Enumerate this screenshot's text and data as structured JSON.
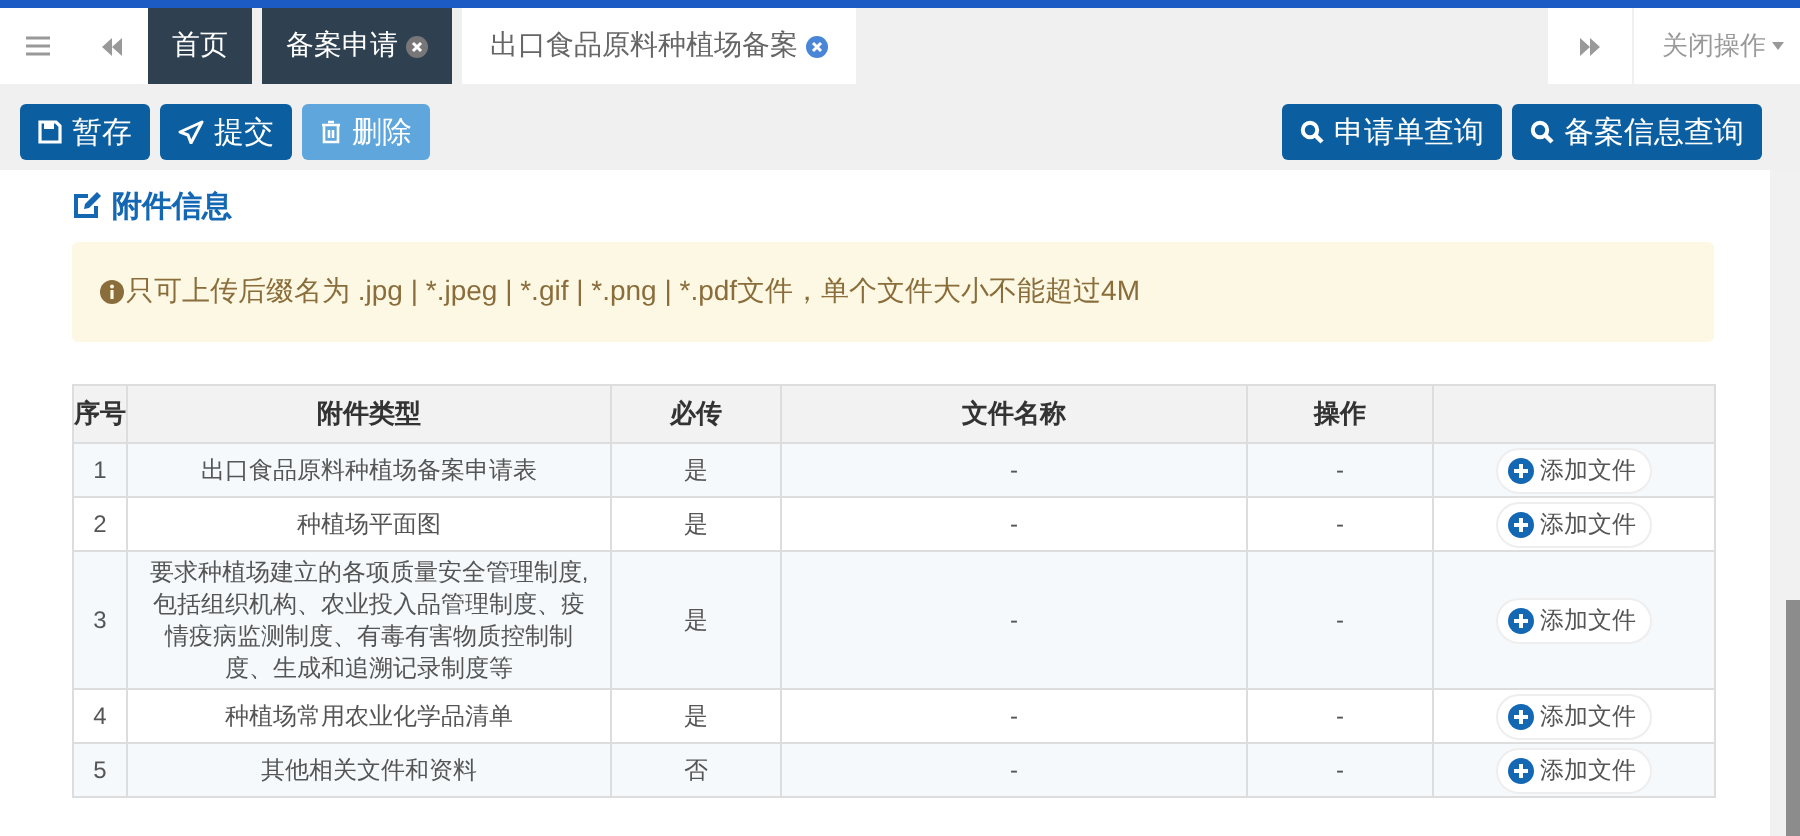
{
  "tab_bar": {
    "tabs": [
      {
        "label": "首页",
        "selected": false,
        "closable": false
      },
      {
        "label": "备案申请",
        "selected": false,
        "closable": true
      },
      {
        "label": "出口食品原料种植场备案",
        "selected": true,
        "closable": true
      }
    ],
    "close_menu": "关闭操作"
  },
  "toolbar": {
    "left_buttons": [
      {
        "label": "暂存",
        "kind": "save",
        "disabled": false
      },
      {
        "label": "提交",
        "kind": "submit",
        "disabled": false
      },
      {
        "label": "删除",
        "kind": "delete",
        "disabled": true
      }
    ],
    "right_buttons": [
      {
        "label": "申请单查询",
        "kind": "query"
      },
      {
        "label": "备案信息查询",
        "kind": "query"
      }
    ]
  },
  "section": {
    "title": "附件信息",
    "notice": "只可上传后缀名为 .jpg | *.jpeg | *.gif | *.png | *.pdf文件，单个文件大小不能超过4M",
    "table": {
      "columns": [
        "序号",
        "附件类型",
        "必传",
        "文件名称",
        "操作"
      ],
      "rows": [
        {
          "index": "1",
          "type": "出口食品原料种植场备案申请表",
          "required": "是",
          "file_name": "-",
          "column_5": "-",
          "action": "添加文件"
        },
        {
          "index": "2",
          "type": "种植场平面图",
          "required": "是",
          "file_name": "-",
          "column_5": "-",
          "action": "添加文件"
        },
        {
          "index": "3",
          "type": "要求种植场建立的各项质量安全管理制度,包括组织机构、农业投入品管理制度、疫情疫病监测制度、有毒有害物质控制制度、生成和追溯记录制度等",
          "required": "是",
          "file_name": "-",
          "column_5": "-",
          "action": "添加文件"
        },
        {
          "index": "4",
          "type": "种植场常用农业化学品清单",
          "required": "是",
          "file_name": "-",
          "column_5": "-",
          "action": "添加文件"
        },
        {
          "index": "5",
          "type": "其他相关文件和资料",
          "required": "否",
          "file_name": "-",
          "column_5": "-",
          "action": "添加文件"
        }
      ]
    }
  }
}
